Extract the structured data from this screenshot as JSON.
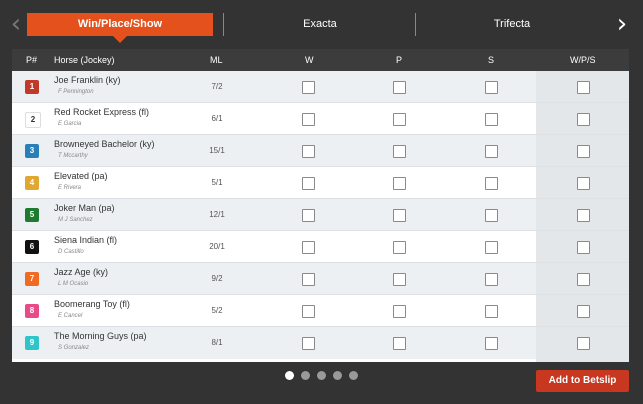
{
  "tabs": [
    {
      "label": "Win/Place/Show",
      "active": true
    },
    {
      "label": "Exacta",
      "active": false
    },
    {
      "label": "Trifecta",
      "active": false
    }
  ],
  "nav": {
    "prev_icon": "chevron-left-icon",
    "next_icon": "chevron-right-icon"
  },
  "columns": {
    "pp": "P#",
    "horse": "Horse (Jockey)",
    "ml": "ML",
    "w": "W",
    "p": "P",
    "s": "S",
    "wps": "W/P/S"
  },
  "runners": [
    {
      "pp": "1",
      "horse": "Joe Franklin (ky)",
      "jockey": "F Pennington",
      "ml": "7/2",
      "color": "#c0392b",
      "text_color": "#ffffff"
    },
    {
      "pp": "2",
      "horse": "Red Rocket Express (fl)",
      "jockey": "E Garcia",
      "ml": "6/1",
      "color": "#ffffff",
      "text_color": "#333333"
    },
    {
      "pp": "3",
      "horse": "Browneyed Bachelor (ky)",
      "jockey": "T Mccarthy",
      "ml": "15/1",
      "color": "#2980b9",
      "text_color": "#ffffff"
    },
    {
      "pp": "4",
      "horse": "Elevated (pa)",
      "jockey": "E Rivera",
      "ml": "5/1",
      "color": "#e0a731",
      "text_color": "#ffffff"
    },
    {
      "pp": "5",
      "horse": "Joker Man (pa)",
      "jockey": "M J Sanchez",
      "ml": "12/1",
      "color": "#1e7a2e",
      "text_color": "#ffffff"
    },
    {
      "pp": "6",
      "horse": "Siena Indian (fl)",
      "jockey": "D Castillo",
      "ml": "20/1",
      "color": "#111111",
      "text_color": "#ffffff"
    },
    {
      "pp": "7",
      "horse": "Jazz Age (ky)",
      "jockey": "L M Ocasio",
      "ml": "9/2",
      "color": "#ef6a22",
      "text_color": "#ffffff"
    },
    {
      "pp": "8",
      "horse": "Boomerang Toy (fl)",
      "jockey": "E Cancel",
      "ml": "5/2",
      "color": "#e84a8a",
      "text_color": "#ffffff"
    },
    {
      "pp": "9",
      "horse": "The Morning Guys (pa)",
      "jockey": "S Gonzalez",
      "ml": "8/1",
      "color": "#2fc4c9",
      "text_color": "#ffffff"
    }
  ],
  "pagination": {
    "pages": 5,
    "current": 1
  },
  "add_button": "Add to Betslip",
  "colors": {
    "accent": "#e4511c",
    "button": "#c8371f",
    "background": "#333333"
  }
}
